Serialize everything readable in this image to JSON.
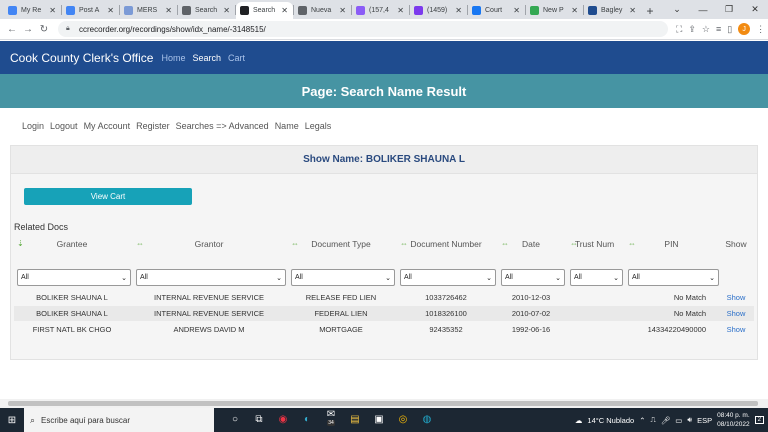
{
  "browser": {
    "tabs": [
      {
        "label": "My Re",
        "color": "#4285f4"
      },
      {
        "label": "Post A",
        "color": "#4285f4"
      },
      {
        "label": "MERS",
        "color": "#7b9ad6"
      },
      {
        "label": "Search",
        "color": "#5f6368"
      },
      {
        "label": "Search",
        "color": "#202124",
        "active": true
      },
      {
        "label": "Nueva",
        "color": "#5f6368"
      },
      {
        "label": "(157,4",
        "color": "#8b5cf6"
      },
      {
        "label": "(1459)",
        "color": "#7c3aed"
      },
      {
        "label": "Court",
        "color": "#1877f2"
      },
      {
        "label": "New P",
        "color": "#34a853"
      },
      {
        "label": "Bagley",
        "color": "#1f4c8f"
      }
    ],
    "url": "ccrecorder.org/recordings/show/idx_name/-3148515/",
    "profile_initial": "J"
  },
  "site": {
    "brand": "Cook County Clerk's Office",
    "nav": [
      "Home",
      "Search",
      "Cart"
    ],
    "banner": "Page: Search Name Result",
    "subnav": [
      "Login",
      "Logout",
      "My Account",
      "Register",
      "Searches => Advanced",
      "Name",
      "Legals"
    ]
  },
  "panel": {
    "show_name": "Show Name: BOLIKER SHAUNA L",
    "view_cart": "View Cart"
  },
  "related_docs": {
    "label": "Related Docs",
    "columns": [
      "Grantee",
      "Grantor",
      "Document Type",
      "Document Number",
      "Date",
      "Trust Num",
      "PIN",
      "Show"
    ],
    "filter_value": "All",
    "rows": [
      [
        "BOLIKER SHAUNA L",
        "INTERNAL REVENUE SERVICE",
        "RELEASE FED LIEN",
        "1033726462",
        "2010-12-03",
        "",
        "No Match",
        "Show"
      ],
      [
        "BOLIKER SHAUNA L",
        "INTERNAL REVENUE SERVICE",
        "FEDERAL LIEN",
        "1018326100",
        "2010-07-02",
        "",
        "No Match",
        "Show"
      ],
      [
        "FIRST NATL BK CHGO",
        "ANDREWS DAVID M",
        "MORTGAGE",
        "92435352",
        "1992-06-16",
        "",
        "14334220490000",
        "Show"
      ]
    ]
  },
  "taskbar": {
    "search_placeholder": "Escribe aquí para buscar",
    "weather": "14°C Nublado",
    "lang": "ESP",
    "time": "08:40 p. m.",
    "date": "08/10/2022",
    "mail_badge": "34",
    "notif_count": "2"
  }
}
